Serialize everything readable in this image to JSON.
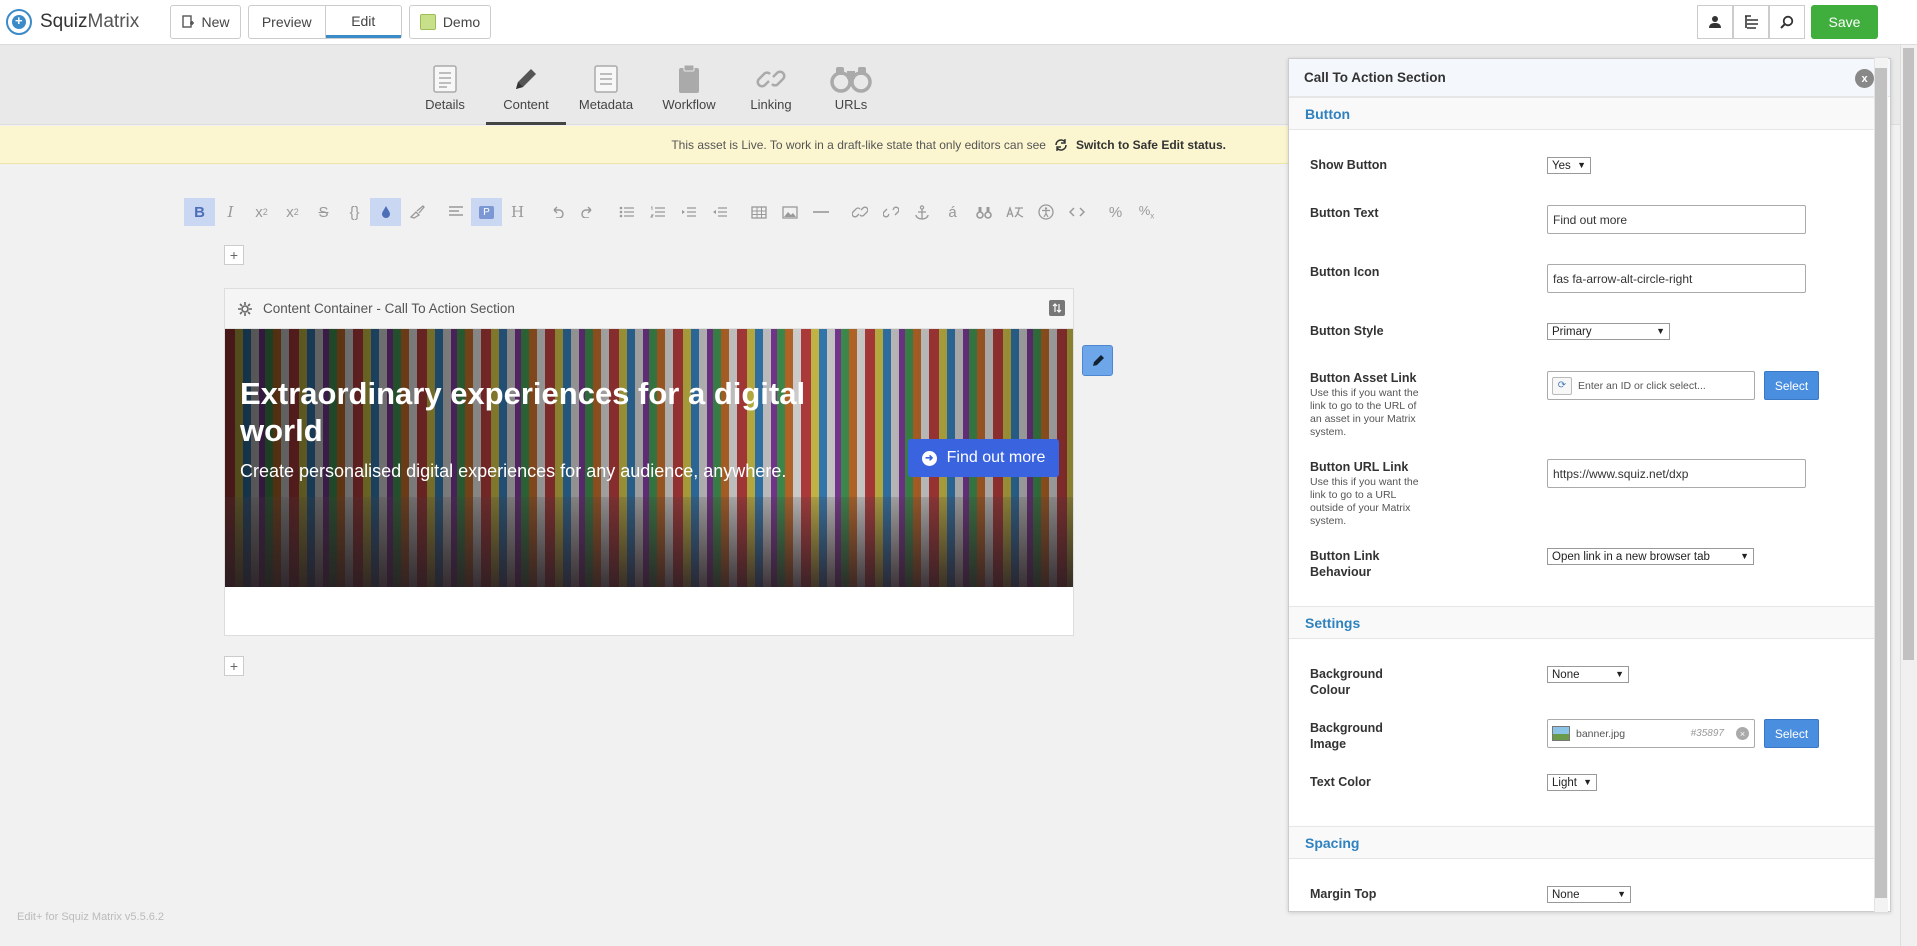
{
  "brand": {
    "name_a": "Squiz",
    "name_b": "Matrix"
  },
  "topbar": {
    "new_label": "New",
    "preview_label": "Preview",
    "edit_label": "Edit",
    "demo_label": "Demo",
    "save_label": "Save"
  },
  "tabs": [
    {
      "label": "Details",
      "icon": "details-icon"
    },
    {
      "label": "Content",
      "icon": "pencil-icon"
    },
    {
      "label": "Metadata",
      "icon": "metadata-icon"
    },
    {
      "label": "Workflow",
      "icon": "clipboard-icon"
    },
    {
      "label": "Linking",
      "icon": "link-icon"
    },
    {
      "label": "URLs",
      "icon": "binoculars-icon"
    }
  ],
  "live_banner": {
    "message": "This asset is Live. To work in a draft-like state that only editors can see",
    "action": "Switch to Safe Edit status."
  },
  "container": {
    "title": "Content Container - Call To Action Section"
  },
  "hero": {
    "title": "Extraordinary experiences for a digital world",
    "subtitle": "Create personalised digital experiences for any audience, anywhere.",
    "button_label": "Find out more"
  },
  "footer": {
    "version": "Edit+ for Squiz Matrix v5.5.6.2"
  },
  "panel": {
    "title": "Call To Action Section",
    "sections": {
      "button": "Button",
      "settings": "Settings",
      "spacing": "Spacing"
    },
    "fields": {
      "show_button": {
        "label": "Show Button",
        "value": "Yes"
      },
      "button_text": {
        "label": "Button Text",
        "value": "Find out more"
      },
      "button_icon": {
        "label": "Button Icon",
        "value": "fas fa-arrow-alt-circle-right"
      },
      "button_style": {
        "label": "Button Style",
        "value": "Primary"
      },
      "button_asset_link": {
        "label": "Button Asset Link",
        "note": "Use this if you want the link to go to the URL of an asset in your Matrix system.",
        "placeholder": "Enter an ID or click select...",
        "select_label": "Select"
      },
      "button_url_link": {
        "label": "Button URL Link",
        "note": "Use this if you want the link to go to a URL outside of your Matrix system.",
        "value": "https://www.squiz.net/dxp"
      },
      "button_link_behaviour": {
        "label_1": "Button Link",
        "label_2": "Behaviour",
        "value": "Open link in a new browser tab"
      },
      "background_colour": {
        "label_1": "Background",
        "label_2": "Colour",
        "value": "None"
      },
      "background_image": {
        "label_1": "Background",
        "label_2": "Image",
        "file": "banner.jpg",
        "asset_id": "#35897",
        "select_label": "Select"
      },
      "text_color": {
        "label": "Text Color",
        "value": "Light"
      },
      "margin_top": {
        "label": "Margin Top",
        "value": "None"
      }
    }
  },
  "colors": {
    "accent": "#3b8bc9",
    "save_green": "#3fae3c",
    "hero_button": "#3a63e0",
    "section_heading": "#2f82be",
    "live_banner_bg": "#fbf6cf"
  }
}
